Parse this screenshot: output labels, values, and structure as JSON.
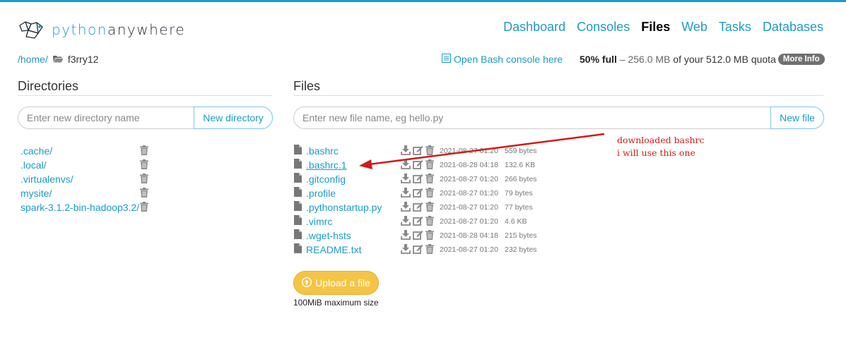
{
  "brand": {
    "name_part1": "python",
    "name_part2": "anywhere",
    "logo_icon": "pythonanywhere-logo-icon"
  },
  "nav": [
    {
      "label": "Dashboard",
      "active": false
    },
    {
      "label": "Consoles",
      "active": false
    },
    {
      "label": "Files",
      "active": true
    },
    {
      "label": "Web",
      "active": false
    },
    {
      "label": "Tasks",
      "active": false
    },
    {
      "label": "Databases",
      "active": false
    }
  ],
  "breadcrumb": {
    "root": "/home/",
    "folder_icon": "folder-open-icon",
    "user": "f3rry12"
  },
  "bash_link": {
    "icon": "console-icon",
    "label": "Open Bash console here"
  },
  "quota": {
    "percent": "50% full",
    "sep": " – ",
    "used": "256.0 MB",
    "of_text": " of your 512.0 MB quota",
    "more_info": "More Info"
  },
  "directories": {
    "title": "Directories",
    "input_placeholder": "Enter new directory name",
    "button": "New directory",
    "items": [
      {
        "name": ".cache/"
      },
      {
        "name": ".local/"
      },
      {
        "name": ".virtualenvs/"
      },
      {
        "name": "mysite/"
      },
      {
        "name": "spark-3.1.2-bin-hadoop3.2/"
      }
    ]
  },
  "files": {
    "title": "Files",
    "input_placeholder": "Enter new file name, eg hello.py",
    "button": "New file",
    "items": [
      {
        "name": ".bashrc",
        "date": "2021-08-27 01:20",
        "size": "559 bytes"
      },
      {
        "name": ".bashrc.1",
        "date": "2021-08-28 04:18",
        "size": "132.6 KB",
        "highlight": true
      },
      {
        "name": ".gitconfig",
        "date": "2021-08-27 01:20",
        "size": "266 bytes"
      },
      {
        "name": ".profile",
        "date": "2021-08-27 01:20",
        "size": "79 bytes"
      },
      {
        "name": ".pythonstartup.py",
        "date": "2021-08-27 01:20",
        "size": "77 bytes"
      },
      {
        "name": ".vimrc",
        "date": "2021-08-27 01:20",
        "size": "4.6 KB"
      },
      {
        "name": ".wget-hsts",
        "date": "2021-08-28 04:18",
        "size": "215 bytes"
      },
      {
        "name": "README.txt",
        "date": "2021-08-27 01:20",
        "size": "232 bytes"
      }
    ],
    "upload_label": "Upload a file",
    "upload_icon": "upload-circle-icon",
    "max_size": "100MiB maximum size"
  },
  "annotation": {
    "line1": "downloaded bashrc",
    "line2": "i will use this one",
    "color": "#d41919"
  },
  "colors": {
    "accent": "#1b9bc8",
    "upload": "#f5c446",
    "pill": "#707070"
  }
}
